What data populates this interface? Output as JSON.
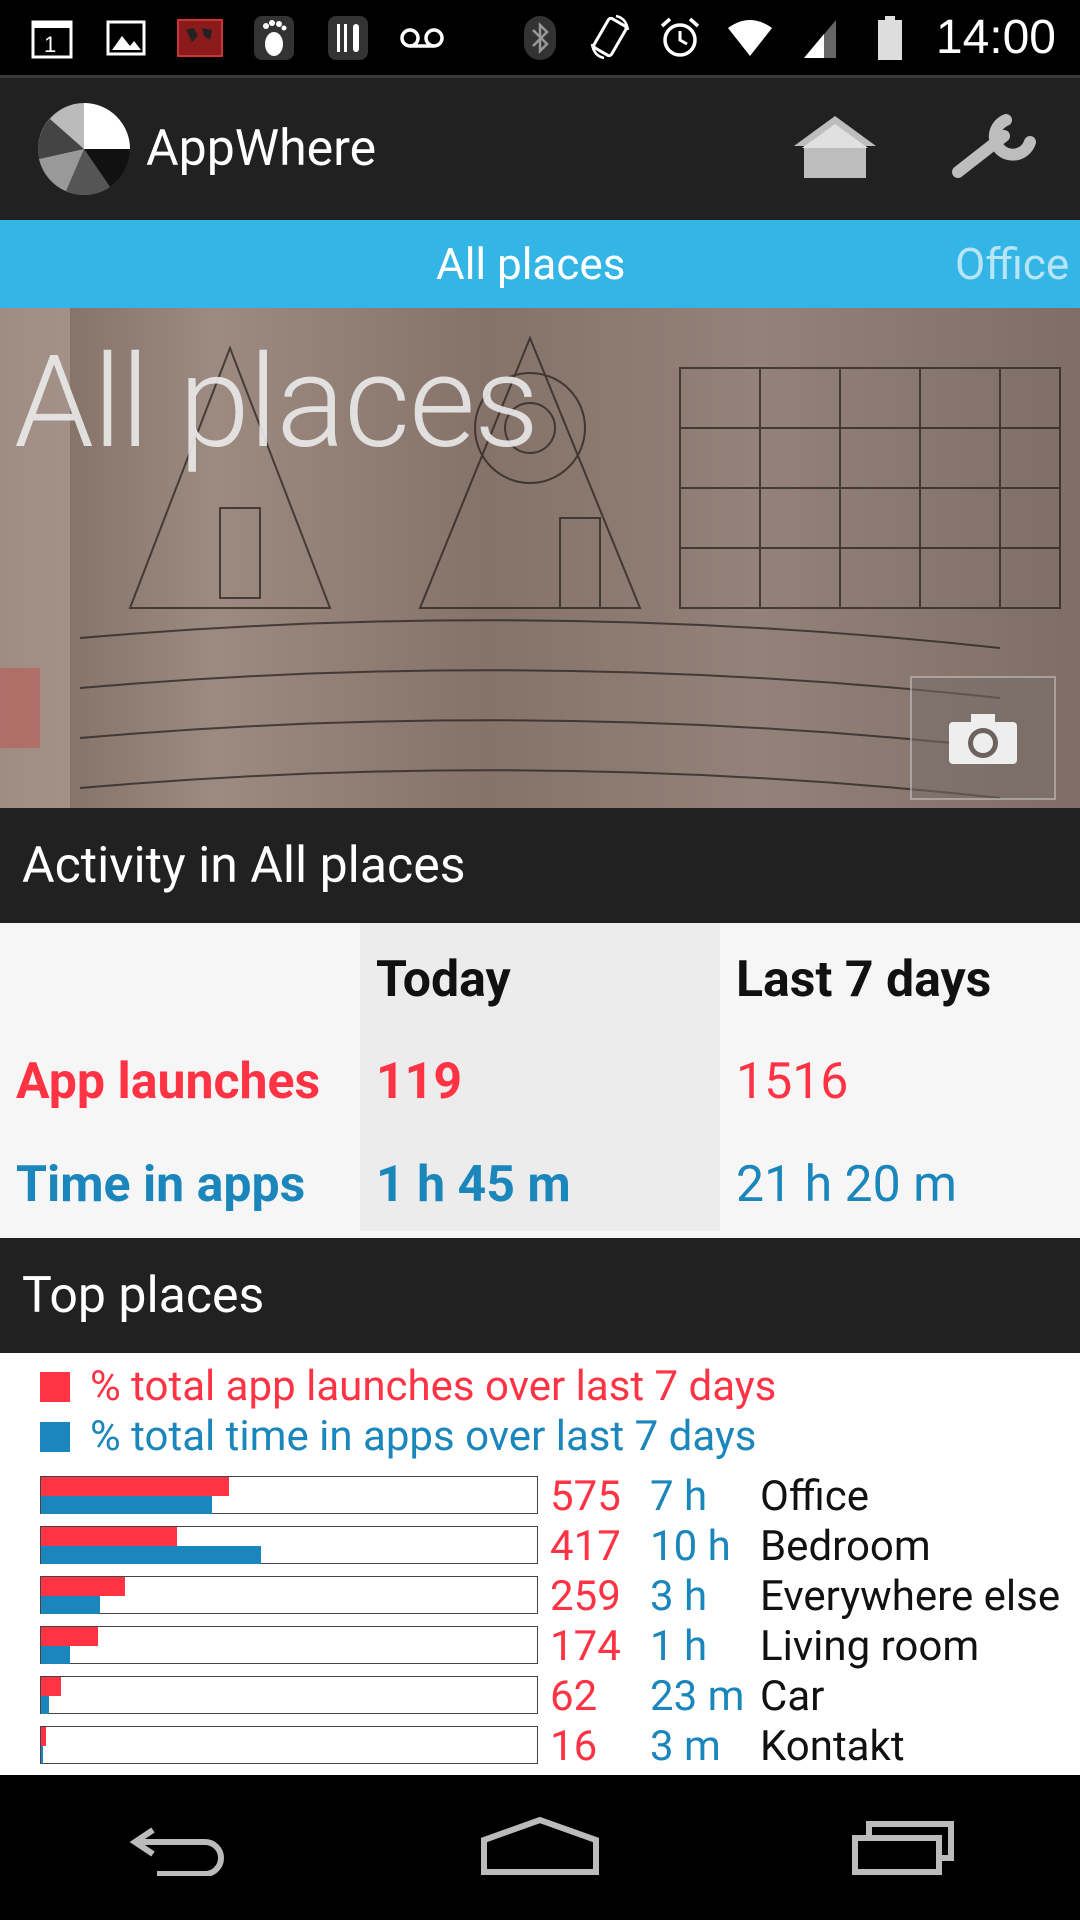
{
  "status_bar": {
    "time": "14:00",
    "left_icons": [
      "calendar-1-icon",
      "gallery-icon",
      "map-icon",
      "footsteps-icon",
      "restaurant-icon",
      "voicemail-icon"
    ],
    "right_icons": [
      "bluetooth-icon",
      "rotate-icon",
      "alarm-icon",
      "wifi-icon",
      "signal-icon",
      "battery-icon"
    ]
  },
  "action_bar": {
    "title": "AppWhere",
    "actions": [
      "home-icon",
      "wrench-icon"
    ]
  },
  "tabs": {
    "active": "All places",
    "next": "Office"
  },
  "hero": {
    "title": "All places"
  },
  "activity": {
    "header": "Activity in All places",
    "col_today": "Today",
    "col_week": "Last 7 days",
    "row_launches": {
      "label": "App launches",
      "today": "119",
      "week": "1516"
    },
    "row_time": {
      "label": "Time in apps",
      "today": "1 h 45 m",
      "week": "21 h 20 m"
    }
  },
  "top_places": {
    "header": "Top places",
    "legend_launches": "% total app launches over last 7 days",
    "legend_time": "% total time in apps over last 7 days",
    "rows": [
      {
        "launches": "575",
        "time": "7 h",
        "name": "Office",
        "launch_pct": 0.38,
        "time_pct": 0.345
      },
      {
        "launches": "417",
        "time": "10 h",
        "name": "Bedroom",
        "launch_pct": 0.275,
        "time_pct": 0.445
      },
      {
        "launches": "259",
        "time": "3 h",
        "name": "Everywhere else",
        "launch_pct": 0.17,
        "time_pct": 0.12
      },
      {
        "launches": "174",
        "time": "1 h",
        "name": "Living room",
        "launch_pct": 0.115,
        "time_pct": 0.058
      },
      {
        "launches": "62",
        "time": "23 m",
        "name": "Car",
        "launch_pct": 0.04,
        "time_pct": 0.016
      },
      {
        "launches": "16",
        "time": "3 m",
        "name": "Kontakt",
        "launch_pct": 0.01,
        "time_pct": 0.003
      }
    ]
  },
  "colors": {
    "tab_bg": "#33b5e5",
    "launch_red": "#ff3344",
    "time_blue": "#1a86bb",
    "dark_bar": "#212121"
  },
  "nav_bar": [
    "back-icon",
    "home-nav-icon",
    "recents-icon"
  ]
}
